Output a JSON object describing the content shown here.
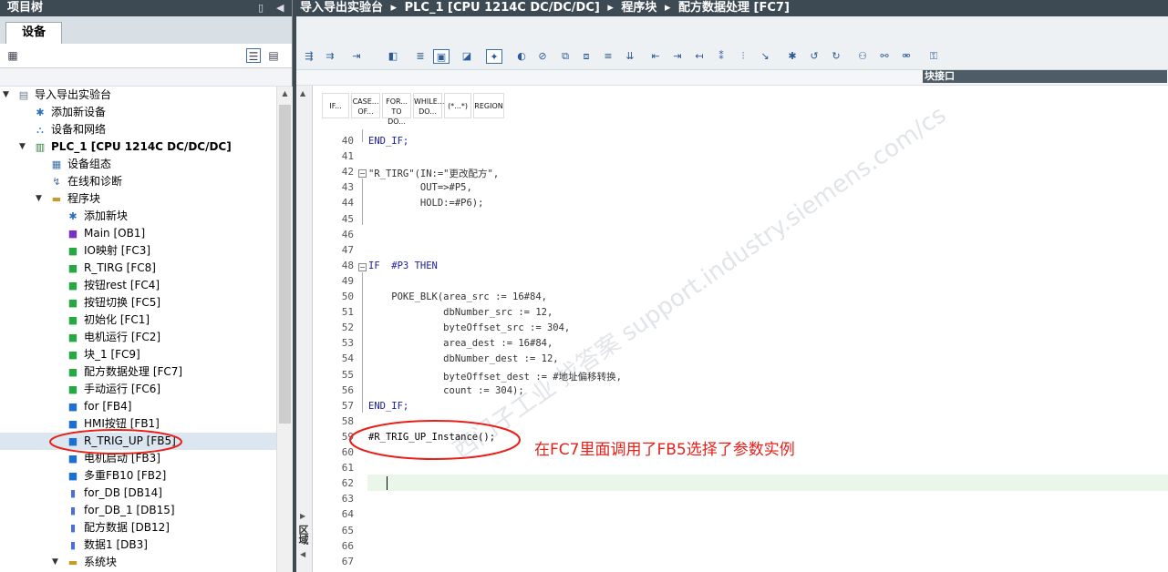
{
  "left_panel": {
    "title": "项目树",
    "tab": "设备",
    "tree": [
      {
        "label": "导入导出实验台",
        "icon": "project-icon",
        "kind": "project"
      },
      {
        "label": "添加新设备",
        "icon": "add-device-icon",
        "kind": "add"
      },
      {
        "label": "设备和网络",
        "icon": "network-icon",
        "kind": "net"
      },
      {
        "label": "PLC_1 [CPU 1214C DC/DC/DC]",
        "icon": "plc-icon",
        "kind": "plc"
      },
      {
        "label": "设备组态",
        "icon": "device-config-icon",
        "kind": "cfg"
      },
      {
        "label": "在线和诊断",
        "icon": "diagnostics-icon",
        "kind": "diag"
      },
      {
        "label": "程序块",
        "icon": "folder-icon",
        "kind": "folder"
      },
      {
        "label": "添加新块",
        "icon": "add-block-icon",
        "kind": "add"
      },
      {
        "label": "Main [OB1]",
        "icon": "ob-icon",
        "kind": "ob"
      },
      {
        "label": "IO映射 [FC3]",
        "icon": "fc-icon",
        "kind": "fc"
      },
      {
        "label": "R_TIRG [FC8]",
        "icon": "fc-icon",
        "kind": "fc"
      },
      {
        "label": "按钮rest [FC4]",
        "icon": "fc-icon",
        "kind": "fc"
      },
      {
        "label": "按钮切换 [FC5]",
        "icon": "fc-icon",
        "kind": "fc"
      },
      {
        "label": "初始化 [FC1]",
        "icon": "fc-icon",
        "kind": "fc"
      },
      {
        "label": "电机运行 [FC2]",
        "icon": "fc-icon",
        "kind": "fc"
      },
      {
        "label": "块_1 [FC9]",
        "icon": "fc-icon",
        "kind": "fc"
      },
      {
        "label": "配方数据处理 [FC7]",
        "icon": "fc-icon",
        "kind": "fc"
      },
      {
        "label": "手动运行 [FC6]",
        "icon": "fc-icon",
        "kind": "fc"
      },
      {
        "label": "for [FB4]",
        "icon": "fb-icon",
        "kind": "fb"
      },
      {
        "label": "HMI按钮 [FB1]",
        "icon": "fb-icon",
        "kind": "fb"
      },
      {
        "label": "R_TRIG_UP [FB5]",
        "icon": "fb-icon",
        "kind": "fb"
      },
      {
        "label": "电机启动 [FB3]",
        "icon": "fb-icon",
        "kind": "fb"
      },
      {
        "label": "多重FB10 [FB2]",
        "icon": "fb-icon",
        "kind": "fb"
      },
      {
        "label": "for_DB [DB14]",
        "icon": "db-icon",
        "kind": "db"
      },
      {
        "label": "for_DB_1 [DB15]",
        "icon": "db-icon",
        "kind": "db"
      },
      {
        "label": "配方数据 [DB12]",
        "icon": "db-icon",
        "kind": "db"
      },
      {
        "label": "数据1 [DB3]",
        "icon": "db-icon",
        "kind": "db"
      },
      {
        "label": "系统块",
        "icon": "folder-icon",
        "kind": "folder"
      }
    ]
  },
  "breadcrumb": [
    "导入导出实验台",
    "PLC_1 [CPU 1214C DC/DC/DC]",
    "程序块",
    "配方数据处理 [FC7]"
  ],
  "interface_label": "块接口",
  "split_label": "区域",
  "keyword_buttons": [
    {
      "l1": "IF...",
      "l2": ""
    },
    {
      "l1": "CASE...",
      "l2": "OF..."
    },
    {
      "l1": "FOR...",
      "l2": "TO DO..."
    },
    {
      "l1": "WHILE...",
      "l2": "DO..."
    },
    {
      "l1": "(*...*)",
      "l2": ""
    },
    {
      "l1": "REGION",
      "l2": ""
    }
  ],
  "code": [
    {
      "n": "40",
      "t": "END_IF;"
    },
    {
      "n": "41",
      "t": ""
    },
    {
      "n": "42",
      "t": "\"R_TIRG\"(IN:=\"更改配方\","
    },
    {
      "n": "43",
      "t": "         OUT=>#P5,"
    },
    {
      "n": "44",
      "t": "         HOLD:=#P6);"
    },
    {
      "n": "45",
      "t": ""
    },
    {
      "n": "46",
      "t": ""
    },
    {
      "n": "47",
      "t": ""
    },
    {
      "n": "48",
      "t": "IF  #P3 THEN"
    },
    {
      "n": "49",
      "t": ""
    },
    {
      "n": "50",
      "t": "    POKE_BLK(area_src := 16#84,"
    },
    {
      "n": "51",
      "t": "             dbNumber_src := 12,"
    },
    {
      "n": "52",
      "t": "             byteOffset_src := 304,"
    },
    {
      "n": "53",
      "t": "             area_dest := 16#84,"
    },
    {
      "n": "54",
      "t": "             dbNumber_dest := 12,"
    },
    {
      "n": "55",
      "t": "             byteOffset_dest := #地址偏移转换,"
    },
    {
      "n": "56",
      "t": "             count := 304);"
    },
    {
      "n": "57",
      "t": "END_IF;"
    },
    {
      "n": "58",
      "t": ""
    },
    {
      "n": "59",
      "t": "#R_TRIG_UP_Instance();"
    },
    {
      "n": "60",
      "t": ""
    },
    {
      "n": "61",
      "t": ""
    },
    {
      "n": "62",
      "t": ""
    },
    {
      "n": "63",
      "t": ""
    },
    {
      "n": "64",
      "t": ""
    },
    {
      "n": "65",
      "t": ""
    },
    {
      "n": "66",
      "t": ""
    },
    {
      "n": "67",
      "t": ""
    }
  ],
  "annotation": "在FC7里面调用了FB5选择了参数实例",
  "watermark": "西门子工业 找答案 support.industry.siemens.com/cs",
  "colors": {
    "annotation": "#e8201a",
    "titlebar": "#3d4a54",
    "selection": "#dbe6f0",
    "current_line": "#e9f6e9"
  }
}
